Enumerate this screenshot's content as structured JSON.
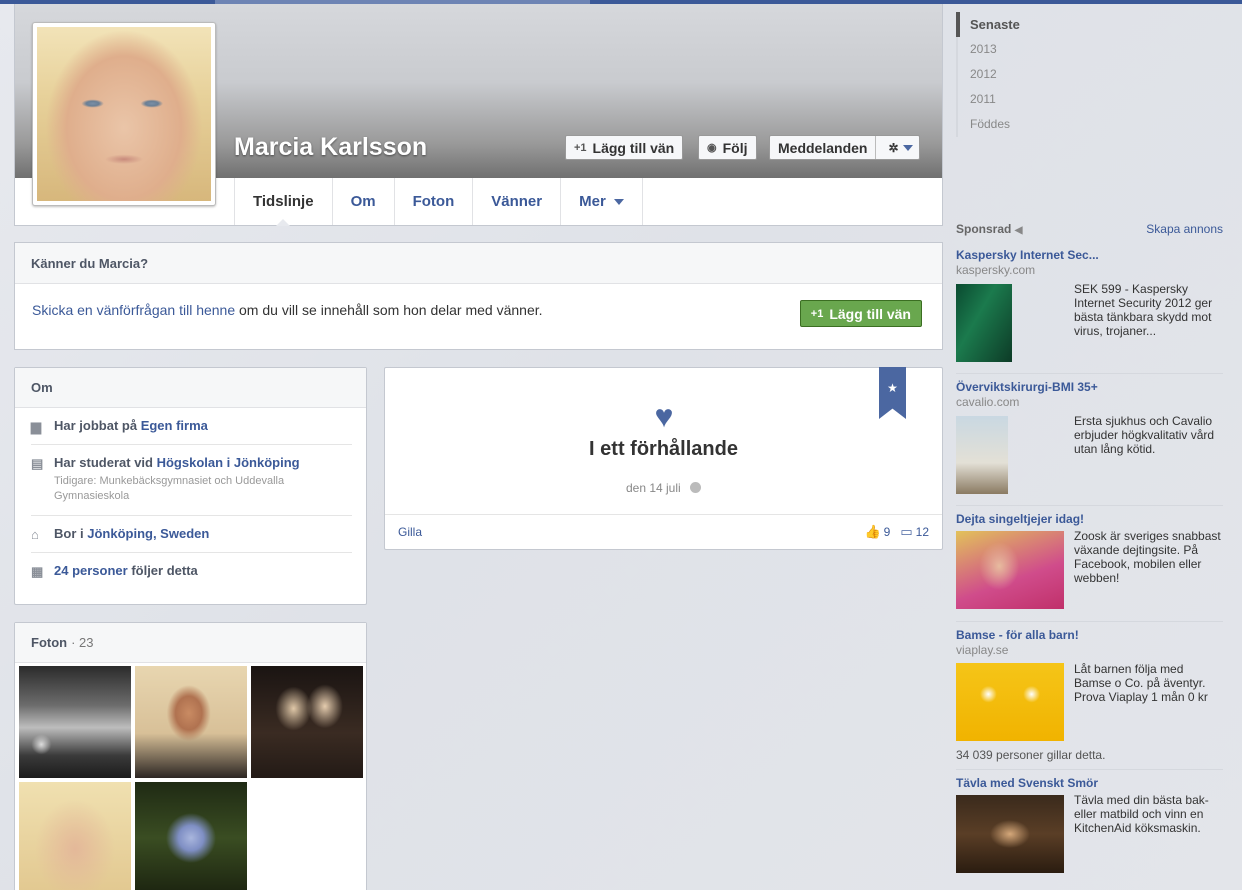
{
  "profile": {
    "name": "Marcia Karlsson",
    "buttons": {
      "add_friend": "Lägg till vän",
      "follow": "Följ",
      "messages": "Meddelanden"
    },
    "tabs": [
      "Tidslinje",
      "Om",
      "Foton",
      "Vänner",
      "Mer"
    ]
  },
  "know_box": {
    "title": "Känner du Marcia?",
    "link_text": "Skicka en vänförfrågan till henne",
    "rest_text": " om du vill se innehåll som hon delar med vänner.",
    "button": "Lägg till vän"
  },
  "om": {
    "title": "Om",
    "work_prefix": "Har jobbat på ",
    "work_link": "Egen firma",
    "study_prefix": "Har studerat vid ",
    "study_link": "Högskolan i Jönköping",
    "study_sub": "Tidigare: Munkebäcksgymnasiet och Uddevalla Gymnasieskola",
    "lives_prefix": "Bor i ",
    "lives_link": "Jönköping, Sweden",
    "followers_link": "24 personer",
    "followers_suffix": " följer detta"
  },
  "photos": {
    "title": "Foton",
    "count": "· 23"
  },
  "life_event": {
    "title": "I ett förhållande",
    "date": "den 14 juli",
    "like_label": "Gilla",
    "likes": "9",
    "comments": "12"
  },
  "timeline_nav": [
    "Senaste",
    "2013",
    "2012",
    "2011",
    "Föddes"
  ],
  "ads": {
    "title": "Sponsrad",
    "create_link": "Skapa annons",
    "items": [
      {
        "title": "Kaspersky Internet Sec...",
        "domain": "kaspersky.com",
        "desc": "SEK 599 - Kaspersky Internet Security 2012 ger bästa tänkbara skydd mot virus, trojaner..."
      },
      {
        "title": "Överviktskirurgi-BMI 35+",
        "domain": "cavalio.com",
        "desc": "Ersta sjukhus och Cavalio erbjuder högkvalitativ vård utan lång kötid."
      },
      {
        "title": "Dejta singeltjejer idag!",
        "domain": "",
        "desc": "Zoosk är sveriges snabbast växande dejtingsite. På Facebook, mobilen eller webben!"
      },
      {
        "title": "Bamse - för alla barn!",
        "domain": "viaplay.se",
        "desc": "Låt barnen följa med Bamse o Co. på äventyr. Prova Viaplay 1 mån 0 kr",
        "extra": "34 039 personer gillar detta."
      },
      {
        "title": "Tävla med Svenskt Smör",
        "domain": "",
        "desc": "Tävla med din bästa bak- eller matbild och vinn en KitchenAid köksmaskin."
      }
    ]
  },
  "colors": {
    "fb_blue": "#3b5998",
    "green_button": "#69a74e"
  }
}
